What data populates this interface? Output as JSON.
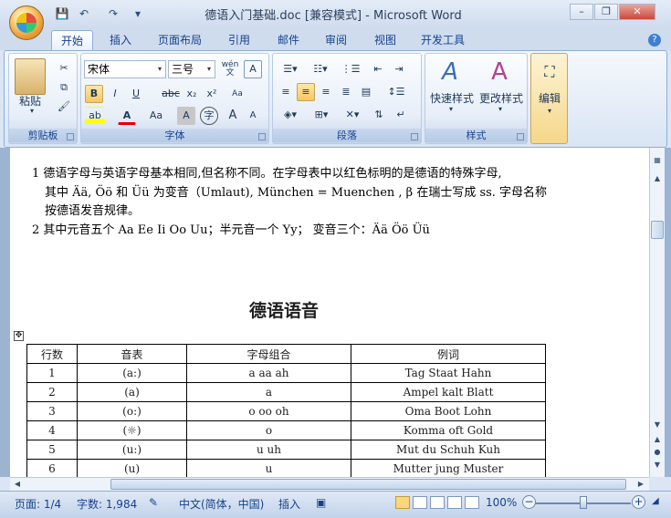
{
  "window": {
    "title": "德语入门基础.doc [兼容模式] - Microsoft Word",
    "minimize": "–",
    "restore": "❐",
    "close": "✕"
  },
  "qat": {
    "save_icon": "💾",
    "undo_icon": "↶",
    "redo_icon": "↷",
    "customize_icon": "▾"
  },
  "tabs": [
    "开始",
    "插入",
    "页面布局",
    "引用",
    "邮件",
    "审阅",
    "视图",
    "开发工具"
  ],
  "help_icon": "?",
  "ribbon": {
    "clipboard": {
      "label": "剪贴板",
      "paste": "粘贴"
    },
    "font": {
      "label": "字体",
      "font_name": "宋体",
      "font_size": "三号",
      "wen": "wén\n文",
      "A_box": "A",
      "bold": "B",
      "italic": "I",
      "underline": "U",
      "strike": "abc",
      "sub": "x₂",
      "sup": "x²",
      "clear": "Aa",
      "highlight": "ab",
      "fontcolor": "A",
      "case": "Aa",
      "charshade": "A",
      "enclose": "字",
      "grow": "A",
      "shrink": "A"
    },
    "paragraph": {
      "label": "段落"
    },
    "styles": {
      "label": "样式",
      "quick": "快速样式",
      "change": "更改样式"
    },
    "editing": {
      "label": "编辑"
    }
  },
  "document": {
    "para1_line1": "1 德语字母与英语字母基本相同,但名称不同。在字母表中以红色标明的是德语的特殊字母,",
    "para1_line2": "其中 Ää, Öö 和 Üü 为变音（Umlaut), München = Muenchen , β  在瑞士写成 ss.  字母名称",
    "para1_line3": "按德语发音规律。",
    "para2": "2 其中元音五个 Aa    Ee    Ii    Oo    Uu；半元音一个 Yy；  变音三个：Ää    Öö    Üü",
    "heading": "德语语音",
    "table": {
      "headers": [
        "行数",
        "音表",
        "字母组合",
        "例词"
      ],
      "rows": [
        [
          "1",
          "(a:)",
          "a    aa    ah",
          "Tag    Staat    Hahn"
        ],
        [
          "2",
          "(a)",
          "a",
          "Ampel    kalt    Blatt"
        ],
        [
          "3",
          "(o:)",
          "o    oo    oh",
          "Oma    Boot    Lohn"
        ],
        [
          "4",
          "(☼)",
          "o",
          "Komma    oft    Gold"
        ],
        [
          "5",
          "(u:)",
          "u    uh",
          "Mut    du    Schuh    Kuh"
        ],
        [
          "6",
          "(u)",
          "u",
          "Mutter    jung    Muster"
        ]
      ]
    }
  },
  "status": {
    "page": "页面: 1/4",
    "words": "字数: 1,984",
    "language": "中文(简体，中国)",
    "insert": "插入",
    "zoom": "100%",
    "zoom_out": "−",
    "zoom_in": "+"
  }
}
